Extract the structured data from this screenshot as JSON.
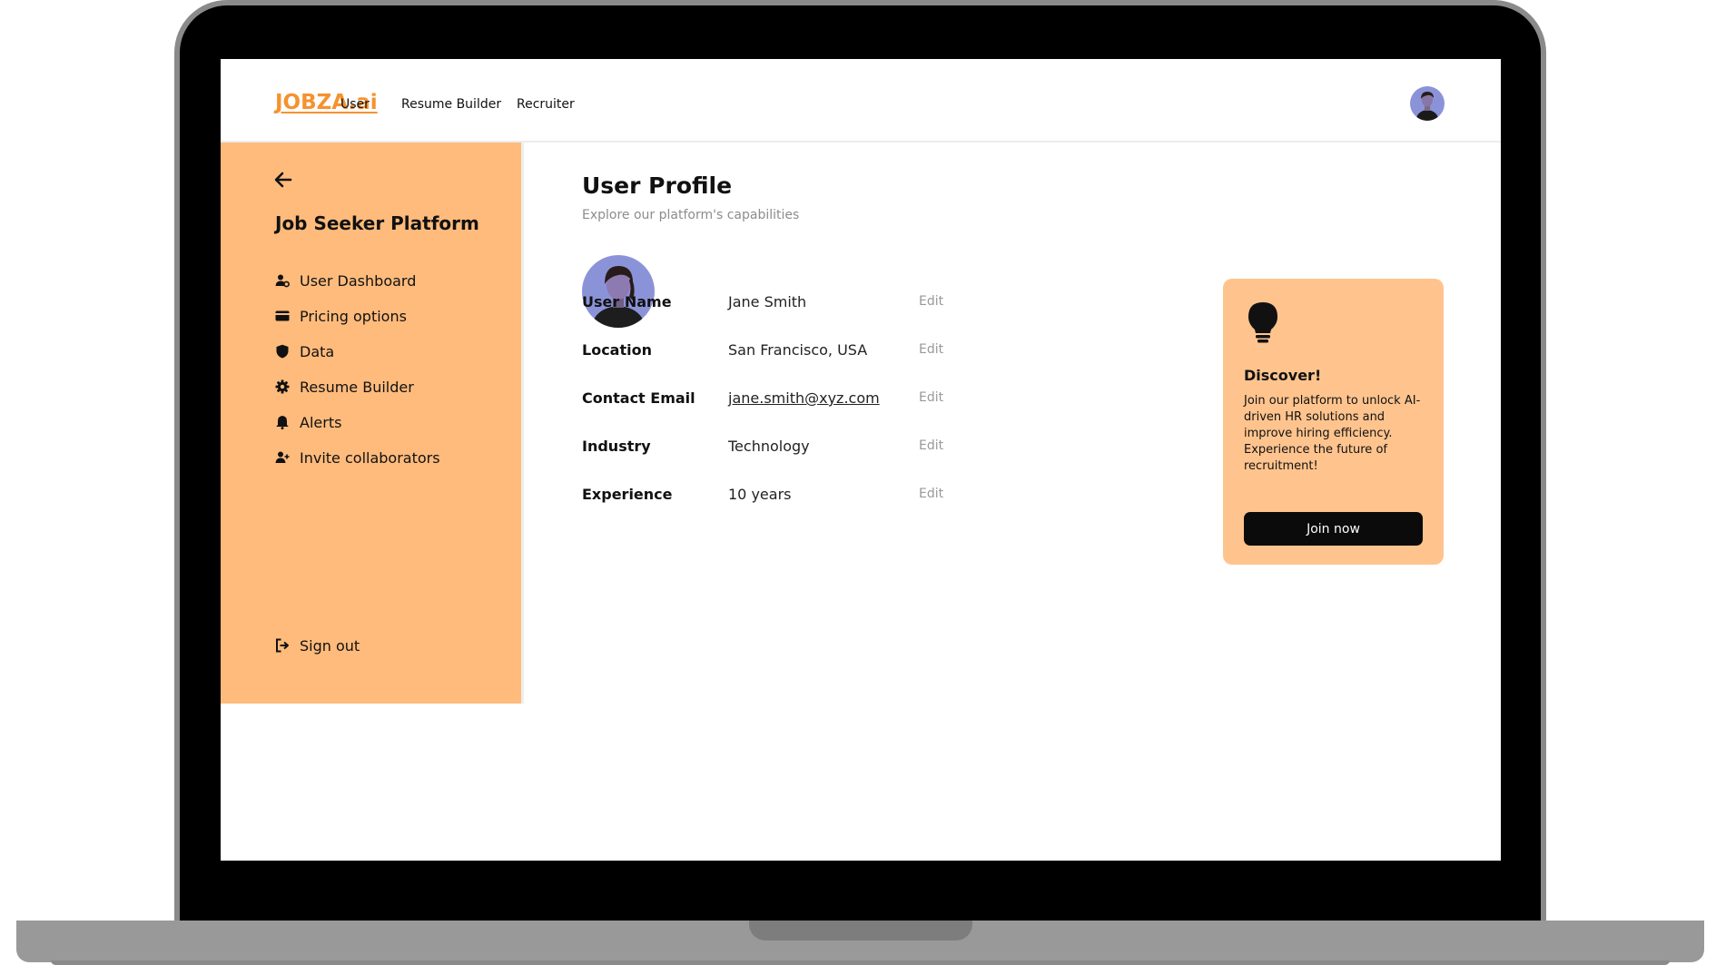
{
  "brand": {
    "logo": "JOBZA.ai",
    "accent_color": "#f5922f",
    "sidebar_color": "#ffbb7c",
    "card_color": "#ffc48e"
  },
  "nav": {
    "links": [
      "User",
      "Resume Builder",
      "Recruiter"
    ]
  },
  "sidebar": {
    "title": "Job Seeker Platform",
    "items": [
      {
        "label": "User Dashboard",
        "icon": "user-gear-icon"
      },
      {
        "label": "Pricing options",
        "icon": "credit-card-icon"
      },
      {
        "label": "Data",
        "icon": "shield-icon"
      },
      {
        "label": "Resume Builder",
        "icon": "gear-icon"
      },
      {
        "label": "Alerts",
        "icon": "bell-icon"
      },
      {
        "label": "Invite collaborators",
        "icon": "user-plus-icon"
      }
    ],
    "signout": {
      "label": "Sign out",
      "icon": "sign-out-icon"
    }
  },
  "main": {
    "title": "User Profile",
    "subtitle": "Explore our platform's capabilities",
    "fields": [
      {
        "label": "User Name",
        "value": "Jane Smith",
        "edit": "Edit"
      },
      {
        "label": "Location",
        "value": "San Francisco, USA",
        "edit": "Edit"
      },
      {
        "label": "Contact Email",
        "value": "jane.smith@xyz.com",
        "edit": "Edit"
      },
      {
        "label": "Industry",
        "value": "Technology",
        "edit": "Edit"
      },
      {
        "label": "Experience",
        "value": "10 years",
        "edit": "Edit"
      }
    ]
  },
  "card": {
    "title": "Discover!",
    "text": "Join our platform to unlock AI-driven HR solutions and improve hiring efficiency. Experience the future of recruitment!",
    "button": "Join now"
  }
}
